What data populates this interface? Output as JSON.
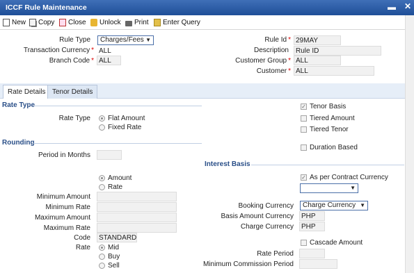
{
  "window": {
    "title": "ICCF Rule Maintenance",
    "min_glyph": "▬",
    "close_glyph": "✕"
  },
  "toolbar": {
    "new_label": "New",
    "copy_label": "Copy",
    "close_label": "Close",
    "unlock_label": "Unlock",
    "print_label": "Print",
    "enter_query_label": "Enter Query"
  },
  "header": {
    "rule_type_label": "Rule Type",
    "rule_type_value": "Charges/Fees",
    "transaction_currency_label": "Transaction Currency",
    "transaction_currency_value": "ALL",
    "branch_code_label": "Branch Code",
    "branch_code_value": "ALL",
    "rule_id_label": "Rule Id",
    "rule_id_value": "29MAY",
    "description_label": "Description",
    "description_value": "Rule ID",
    "customer_group_label": "Customer Group",
    "customer_group_value": "ALL",
    "customer_label": "Customer",
    "customer_value": "ALL",
    "required_mark": "*"
  },
  "tabs": {
    "rate_details": "Rate Details",
    "tenor_details": "Tenor Details"
  },
  "rate_type": {
    "section_title": "Rate Type",
    "label": "Rate Type",
    "options": [
      "Flat Amount",
      "Fixed Rate"
    ],
    "selected": "Flat Amount"
  },
  "tenor": {
    "tenor_basis": "Tenor Basis",
    "tiered_amount": "Tiered Amount",
    "tiered_tenor": "Tiered Tenor",
    "duration_based": "Duration Based",
    "tenor_basis_checked": true
  },
  "rounding": {
    "section_title": "Rounding",
    "period_in_months_label": "Period in Months",
    "period_in_months_value": "",
    "basis_options": [
      "Amount",
      "Rate"
    ],
    "basis_selected": "Amount",
    "minimum_amount_label": "Minimum Amount",
    "minimum_rate_label": "Minimum Rate",
    "maximum_amount_label": "Maximum Amount",
    "maximum_rate_label": "Maximum Rate",
    "code_label": "Code",
    "code_value": "STANDARD",
    "rate_label": "Rate",
    "rate_options": [
      "Mid",
      "Buy",
      "Sell"
    ],
    "rate_selected": "Mid"
  },
  "interest_basis": {
    "section_title": "Interest Basis",
    "as_per_contract_currency": "As per Contract Currency",
    "as_per_contract_checked": true,
    "currency_select_value": "",
    "booking_currency_label": "Booking Currency",
    "booking_currency_value": "Charge Currency",
    "basis_amount_currency_label": "Basis Amount Currency",
    "basis_amount_currency_value": "PHP",
    "charge_currency_label": "Charge Currency",
    "charge_currency_value": "PHP",
    "cascade_amount": "Cascade Amount",
    "rate_period_label": "Rate Period",
    "minimum_commission_period_label": "Minimum Commission Period"
  }
}
